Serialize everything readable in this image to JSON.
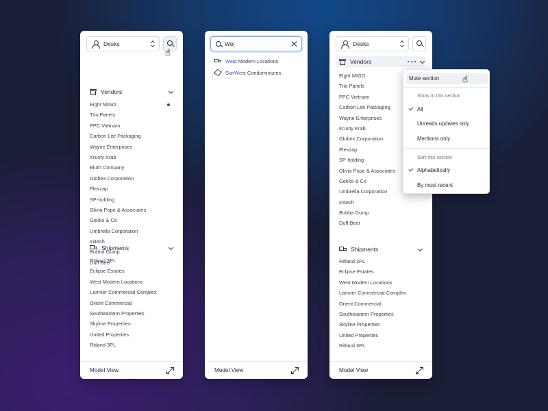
{
  "panel1": {
    "desk_select": "Desks",
    "vendors_title": "Vendors",
    "vendors": [
      "Eight MIGO",
      "Trio Panels",
      "PPC Vietnam",
      "Carbon Lite Packaging",
      "Wayne Enterprises",
      "Krusty Krab",
      "Bluth Company",
      "Globex Corporation",
      "Plexzap",
      "SP-holding",
      "Olivia Pope & Associates",
      "Gekko & Co",
      "Umbrella Corporation",
      "Initech",
      "Bubba Gump",
      "Duff Beer"
    ],
    "shipments_title": "Shipments",
    "shipments": [
      "Ritland 3PL",
      "Eclipse Estates",
      "West Modern Locations",
      "Larmier Commercial Complex",
      "Orient Commercial",
      "Southeastern Properties",
      "Skyline Properties",
      "United Properties",
      "Ritland 3PL"
    ],
    "footer": "Model View"
  },
  "panel2": {
    "search_value": "We|",
    "results": [
      {
        "pre": "",
        "match": "We",
        "post": "st Modern Locations"
      },
      {
        "pre": "Sun ",
        "match": "We",
        "post": "st Condominiums"
      }
    ],
    "footer": "Model View"
  },
  "panel3": {
    "desk_select": "Desks",
    "vendors_title": "Vendors",
    "vendors": [
      "Eight MIGO",
      "Trio Panels",
      "PPC Vietnam",
      "Carbon Lite Packaging",
      "Wayne Enterprises",
      "Krusty Krab",
      "Globex Corporation",
      "Plexzap",
      "SP-holding",
      "Olivia Pope & Associates",
      "Gekko & Co",
      "Umbrella Corporation",
      "Initech",
      "Bubba Gump",
      "Duff Beer"
    ],
    "shipments_title": "Shipments",
    "shipments": [
      "Ritland 3PL",
      "Eclipse Estates",
      "West Modern Locations",
      "Larmier Commercial Complex",
      "Orient Commercial",
      "Southeastern Properties",
      "Skyline Properties",
      "United Properties",
      "Ritland 3PL"
    ],
    "footer": "Model View",
    "menu": {
      "mute": "Mute section",
      "show_header": "Show in this section",
      "show_all": "All",
      "show_unreads": "Unreads updates only",
      "show_mentions": "Mentions only",
      "sort_header": "Sort this section",
      "sort_alpha": "Alphabetically",
      "sort_recent": "By most recent"
    }
  }
}
